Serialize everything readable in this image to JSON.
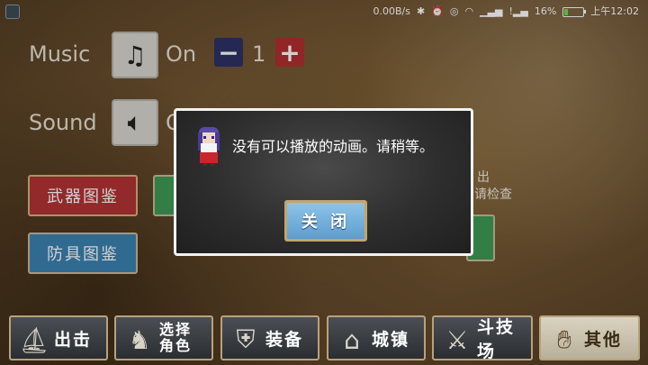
{
  "status_bar": {
    "net_speed": "0.00B/s",
    "battery_text": "16%",
    "battery_fraction": 0.16,
    "time": "上午12:02"
  },
  "settings": {
    "music_label": "Music",
    "music_value": "On",
    "volume_value": "1",
    "sound_label": "Sound",
    "sound_value_partial": "O"
  },
  "library": {
    "weapon_book": "武器图鉴",
    "armor_book": "防具图鉴"
  },
  "side_note": {
    "line1": "出",
    "line2": "请检查"
  },
  "dialog": {
    "message": "没有可以播放的动画。请稍等。",
    "close_label": "关 闭"
  },
  "bottom_nav": [
    {
      "label": "出击",
      "icon": "boat-icon"
    },
    {
      "label": "选择\n角色",
      "label_line1": "选择",
      "label_line2": "角色",
      "icon": "character-select-icon"
    },
    {
      "label": "装备",
      "icon": "armor-icon"
    },
    {
      "label": "城镇",
      "icon": "town-icon"
    },
    {
      "label": "斗技场",
      "icon": "crossed-swords-icon"
    },
    {
      "label": "其他",
      "icon": "hand-icon"
    }
  ],
  "colors": {
    "minus_button": "#2d3166",
    "plus_button": "#b02f2f",
    "weapon_button": "#b23234",
    "armor_button": "#3c82b0",
    "close_button": "#6fa9d6"
  }
}
